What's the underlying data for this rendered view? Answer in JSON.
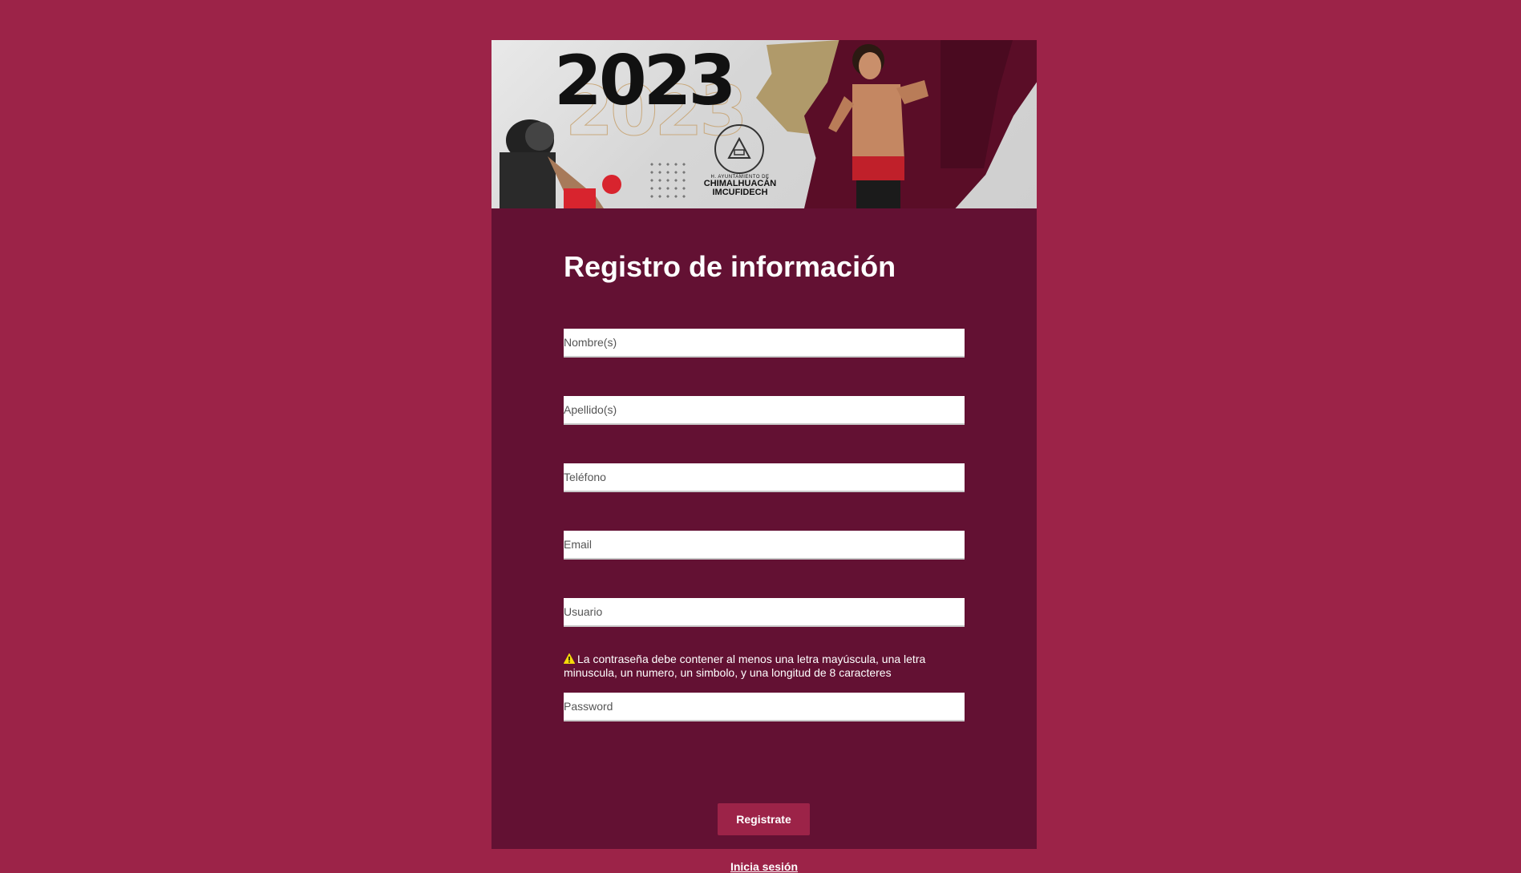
{
  "banner": {
    "year": "2023",
    "seal_line1": "H. AYUNTAMIENTO DE",
    "seal_line2": "CHIMALHUACÁN",
    "seal_line3": "IMCUFIDECH"
  },
  "form": {
    "title": "Registro de información",
    "fields": {
      "nombre_placeholder": "Nombre(s)",
      "apellido_placeholder": "Apellido(s)",
      "telefono_placeholder": "Teléfono",
      "email_placeholder": "Email",
      "usuario_placeholder": "Usuario",
      "password_placeholder": "Password"
    },
    "password_hint": "La contraseña debe contener al menos una letra mayúscula, una letra minuscula, un numero, un simbolo, y una longitud de 8 caracteres",
    "submit_label": "Registrate",
    "login_link": "Inicia sesión"
  },
  "icons": {
    "warning": "warning-icon"
  },
  "colors": {
    "page_background": "#9c2348",
    "card_background": "#631133",
    "button_background": "#9c2348",
    "warning_icon": "#f5d90a"
  }
}
